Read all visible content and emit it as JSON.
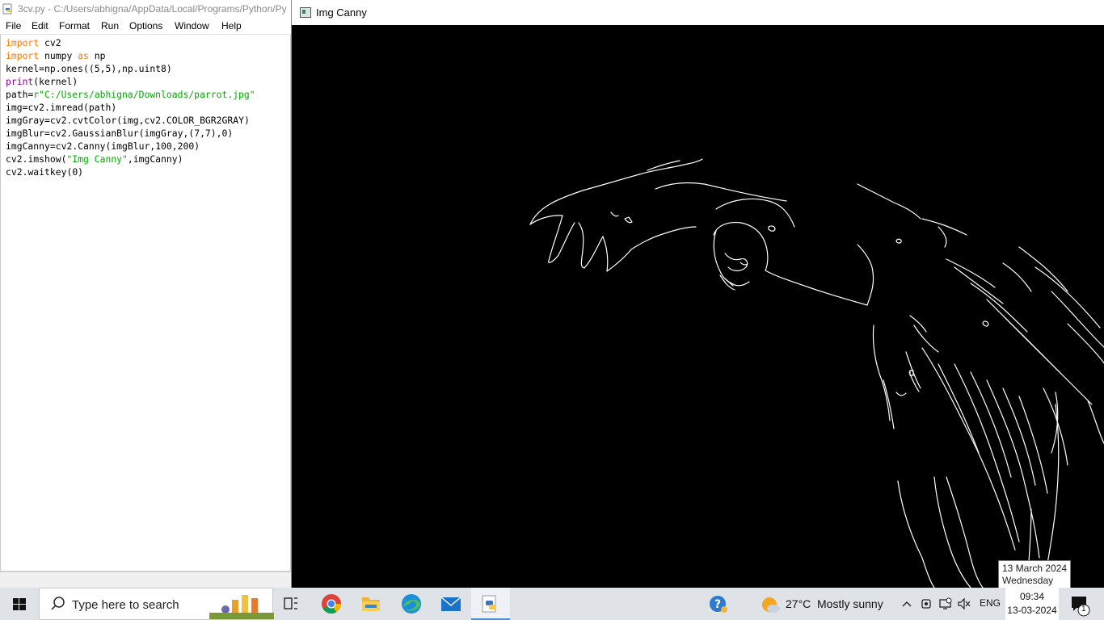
{
  "idle": {
    "title": "3cv.py - C:/Users/abhigna/AppData/Local/Programs/Python/Py",
    "menu": [
      "File",
      "Edit",
      "Format",
      "Run",
      "Options",
      "Window",
      "Help"
    ],
    "code": [
      "import cv2",
      "import numpy as np",
      "kernel=np.ones((5,5),np.uint8)",
      "print(kernel)",
      "path=r\"C:/Users/abhigna/Downloads/parrot.jpg\"",
      "img=cv2.imread(path)",
      "imgGray=cv2.cvtColor(img,cv2.COLOR_BGR2GRAY)",
      "imgBlur=cv2.GaussianBlur(imgGray,(7,7),0)",
      "imgCanny=cv2.Canny(imgBlur,100,200)",
      "cv2.imshow(\"Img Canny\",imgCanny)",
      "cv2.waitkey(0)"
    ]
  },
  "cv_window": {
    "title": "Img Canny",
    "image_icon": "parrot-edge-image"
  },
  "tooltip": {
    "date": "13 March 2024",
    "day": "Wednesday"
  },
  "taskbar": {
    "search_placeholder": "Type here to search",
    "apps": [
      "task-view-icon",
      "chrome-icon",
      "file-explorer-icon",
      "edge-icon",
      "mail-icon",
      "python-idle-icon"
    ],
    "weather": {
      "temp": "27°C",
      "condition": "Mostly sunny"
    },
    "language": "ENG",
    "time": "09:34",
    "date": "13-03-2024",
    "notification_count": "1"
  },
  "colors": {
    "keyword": "#ff7700",
    "builtin": "#900090",
    "string": "#00aa00",
    "taskbar": "#dfe3e8"
  }
}
